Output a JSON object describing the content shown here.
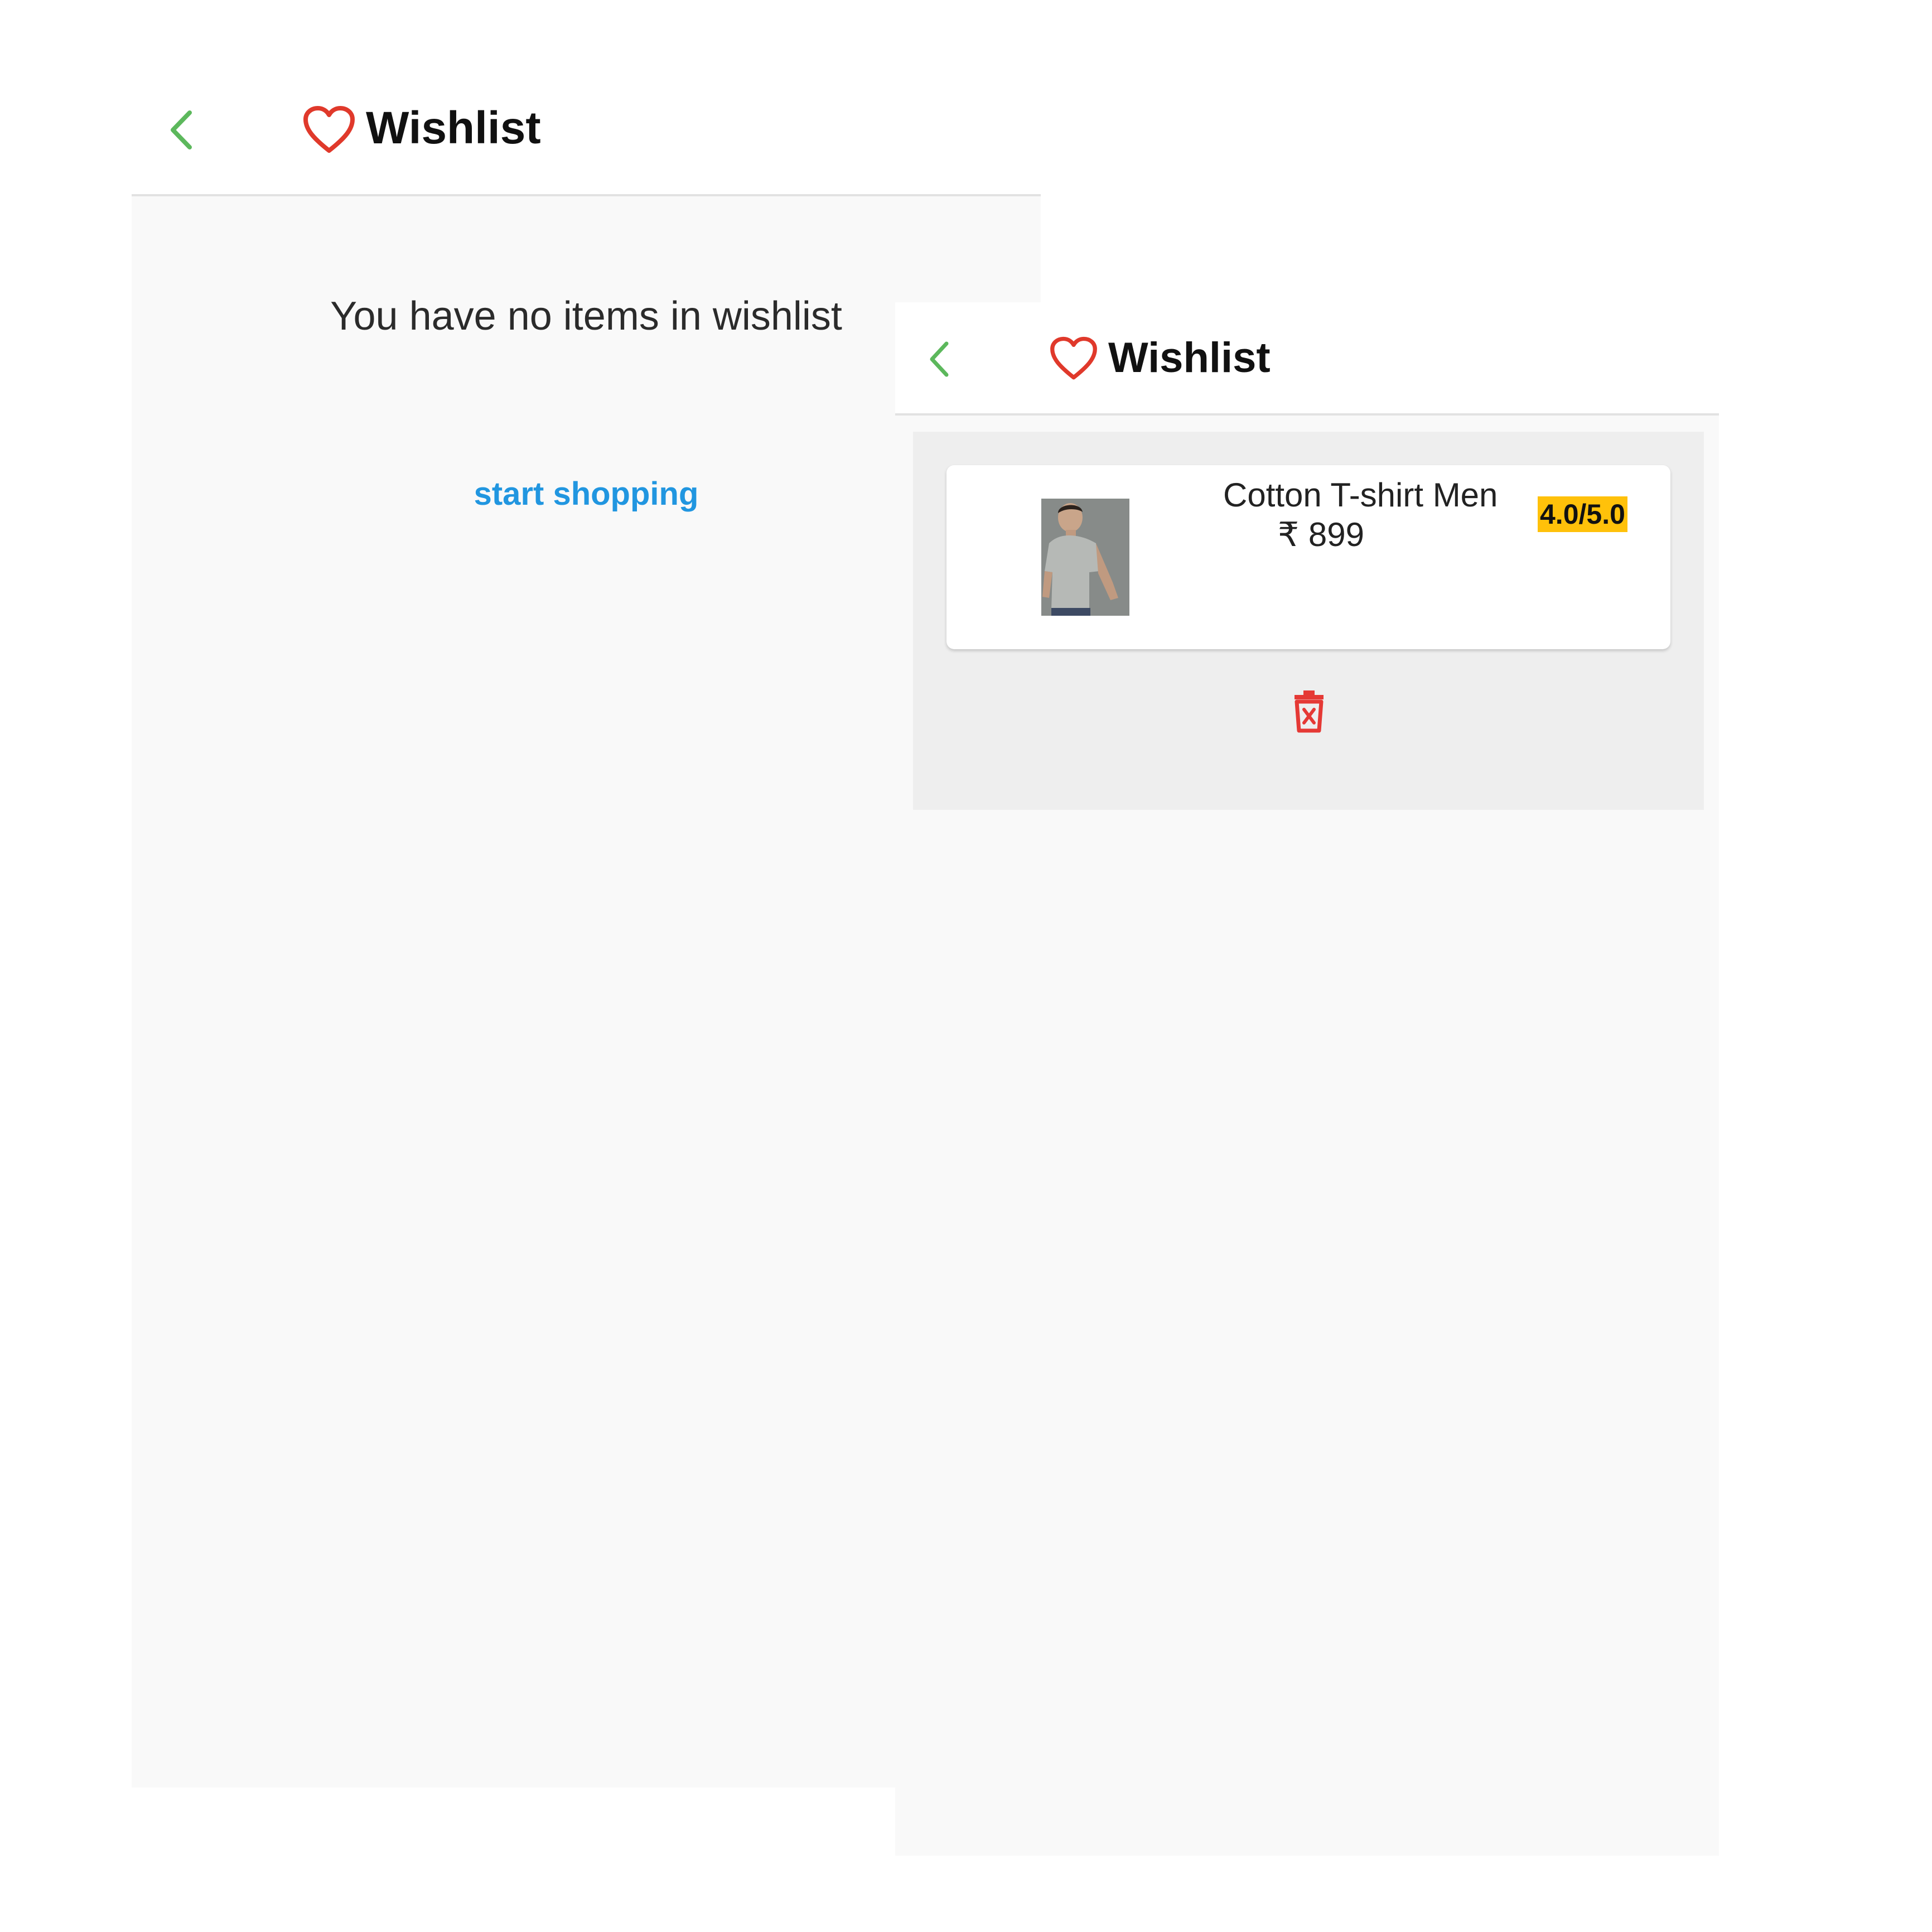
{
  "empty_screen": {
    "title": "Wishlist",
    "message": "You have no items in wishlist",
    "link_label": "start shopping",
    "icons": {
      "back": "chevron-left-icon",
      "title": "heart-icon"
    }
  },
  "wishlist_screen": {
    "title": "Wishlist",
    "icons": {
      "back": "chevron-left-icon",
      "title": "heart-icon",
      "remove": "trash-icon"
    },
    "items": [
      {
        "name": "Cotton T-shirt Men",
        "price": "₹ 899",
        "rating": "4.0/5.0"
      }
    ]
  },
  "colors": {
    "accent_green": "#5cb85c",
    "heart_red": "#e0392b",
    "link_blue": "#2196e0",
    "rating_yellow": "#ffc10a",
    "trash_red": "#e53935"
  }
}
